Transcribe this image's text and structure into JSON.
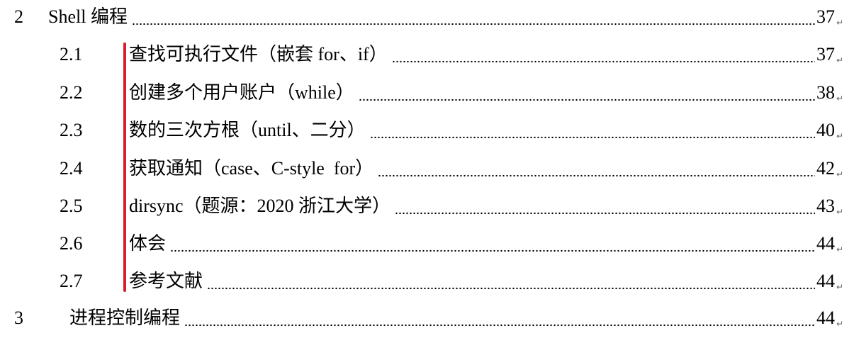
{
  "toc": {
    "chapter2": {
      "number": "2",
      "title": "Shell 编程",
      "page": "37"
    },
    "sections": [
      {
        "number": "2.1",
        "title": "查找可执行文件（嵌套 for、if）",
        "page": "37"
      },
      {
        "number": "2.2",
        "title": "创建多个用户账户（while）",
        "page": "38"
      },
      {
        "number": "2.3",
        "title": "数的三次方根（until、二分）",
        "page": "40"
      },
      {
        "number": "2.4",
        "title": "获取通知（case、C-style  for）",
        "page": "42"
      },
      {
        "number": "2.5",
        "title": "dirsync（题源：2020 浙江大学）",
        "page": "43"
      },
      {
        "number": "2.6",
        "title": "体会",
        "page": "44"
      },
      {
        "number": "2.7",
        "title": "参考文献",
        "page": "44"
      }
    ],
    "chapter3": {
      "number": "3",
      "title": "进程控制编程",
      "page": "44"
    },
    "para_mark": "↵"
  },
  "colors": {
    "highlight_bar": "#d81e2c"
  }
}
